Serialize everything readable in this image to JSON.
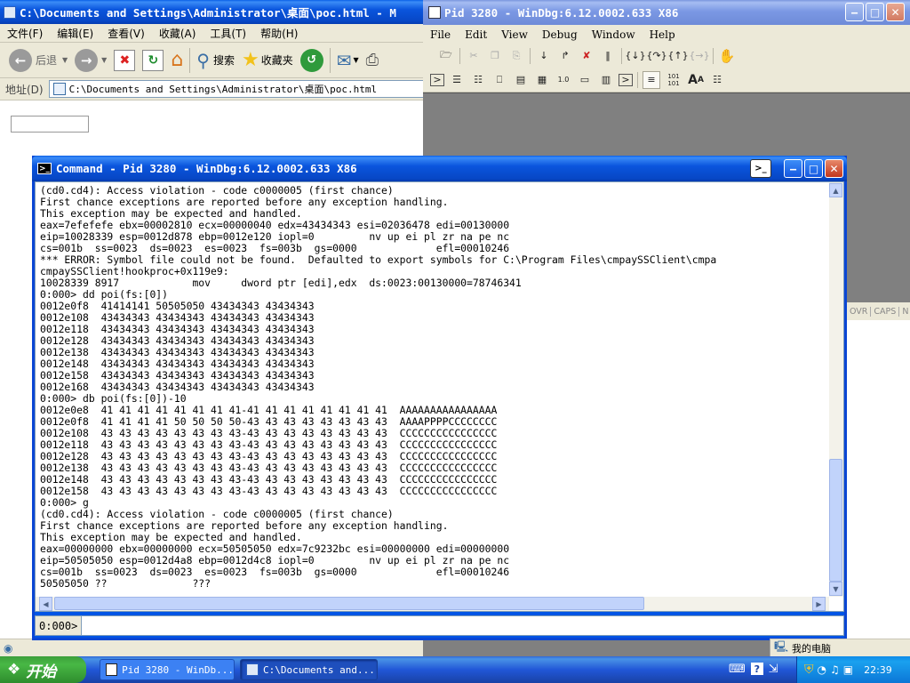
{
  "ie": {
    "title": "C:\\Documents and Settings\\Administrator\\桌面\\poc.html - M",
    "menu": [
      "文件(F)",
      "编辑(E)",
      "查看(V)",
      "收藏(A)",
      "工具(T)",
      "帮助(H)"
    ],
    "toolbar": {
      "back": "后退",
      "search": "搜索",
      "favorites": "收藏夹"
    },
    "address_label": "地址(D)",
    "address_value": "C:\\Documents and Settings\\Administrator\\桌面\\poc.html"
  },
  "windbg": {
    "title": "Pid 3280 - WinDbg:6.12.0002.633 X86",
    "menu": [
      "File",
      "Edit",
      "View",
      "Debug",
      "Window",
      "Help"
    ],
    "status_cells": [
      "OVR",
      "CAPS",
      "N"
    ]
  },
  "command": {
    "title": "Command - Pid 3280 - WinDbg:6.12.0002.633 X86",
    "prompt": "0:000>",
    "lines": [
      "(cd0.cd4): Access violation - code c0000005 (first chance)",
      "First chance exceptions are reported before any exception handling.",
      "This exception may be expected and handled.",
      "eax=7efefefe ebx=00002810 ecx=00000040 edx=43434343 esi=02036478 edi=00130000",
      "eip=10028339 esp=0012d878 ebp=0012e120 iopl=0         nv up ei pl zr na pe nc",
      "cs=001b  ss=0023  ds=0023  es=0023  fs=003b  gs=0000             efl=00010246",
      "*** ERROR: Symbol file could not be found.  Defaulted to export symbols for C:\\Program Files\\cmpaySSClient\\cmpa",
      "cmpaySSClient!hookproc+0x119e9:",
      "10028339 8917            mov     dword ptr [edi],edx  ds:0023:00130000=78746341",
      "0:000> dd poi(fs:[0])",
      "0012e0f8  41414141 50505050 43434343 43434343",
      "0012e108  43434343 43434343 43434343 43434343",
      "0012e118  43434343 43434343 43434343 43434343",
      "0012e128  43434343 43434343 43434343 43434343",
      "0012e138  43434343 43434343 43434343 43434343",
      "0012e148  43434343 43434343 43434343 43434343",
      "0012e158  43434343 43434343 43434343 43434343",
      "0012e168  43434343 43434343 43434343 43434343",
      "0:000> db poi(fs:[0])-10",
      "0012e0e8  41 41 41 41 41 41 41 41-41 41 41 41 41 41 41 41  AAAAAAAAAAAAAAAA",
      "0012e0f8  41 41 41 41 50 50 50 50-43 43 43 43 43 43 43 43  AAAAPPPPCCCCCCCC",
      "0012e108  43 43 43 43 43 43 43 43-43 43 43 43 43 43 43 43  CCCCCCCCCCCCCCCC",
      "0012e118  43 43 43 43 43 43 43 43-43 43 43 43 43 43 43 43  CCCCCCCCCCCCCCCC",
      "0012e128  43 43 43 43 43 43 43 43-43 43 43 43 43 43 43 43  CCCCCCCCCCCCCCCC",
      "0012e138  43 43 43 43 43 43 43 43-43 43 43 43 43 43 43 43  CCCCCCCCCCCCCCCC",
      "0012e148  43 43 43 43 43 43 43 43-43 43 43 43 43 43 43 43  CCCCCCCCCCCCCCCC",
      "0012e158  43 43 43 43 43 43 43 43-43 43 43 43 43 43 43 43  CCCCCCCCCCCCCCCC",
      "0:000> g",
      "(cd0.cd4): Access violation - code c0000005 (first chance)",
      "First chance exceptions are reported before any exception handling.",
      "This exception may be expected and handled.",
      "eax=00000000 ebx=00000000 ecx=50505050 edx=7c9232bc esi=00000000 edi=00000000",
      "eip=50505050 esp=0012d4a8 ebp=0012d4c8 iopl=0         nv up ei pl zr na pe nc",
      "cs=001b  ss=0023  ds=0023  es=0023  fs=003b  gs=0000             efl=00010246",
      "50505050 ??              ???"
    ]
  },
  "taskbar": {
    "start": "开始",
    "tasks": [
      "Pid 3280 - WinDb...",
      "C:\\Documents and..."
    ],
    "clock": "22:39"
  },
  "ie_status": {
    "zone": "我的电脑"
  }
}
